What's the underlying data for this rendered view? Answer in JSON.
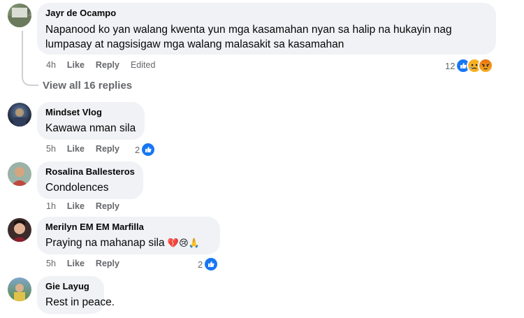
{
  "comments": [
    {
      "author": "Jayr de Ocampo",
      "lines": [
        "Napanood ko yan walang kwenta yun mga kasamahan nyan sa halip na hukayin nag",
        "lumpasay at nagsisigaw mga walang malasakit sa kasamahan"
      ],
      "time": "4h",
      "like": "Like",
      "reply": "Reply",
      "edited": "Edited",
      "reaction_count": "12",
      "reactions": [
        "like-icon",
        "sad-icon",
        "angry-icon"
      ]
    },
    {
      "author": "Mindset Vlog",
      "text": "Kawawa nman sila",
      "time": "5h",
      "like": "Like",
      "reply": "Reply",
      "reaction_count": "2"
    },
    {
      "author": "Rosalina Ballesteros",
      "text": "Condolences",
      "time": "1h",
      "like": "Like",
      "reply": "Reply"
    },
    {
      "author": "Merilyn EM EM Marfilla",
      "text": "Praying na mahanap sila",
      "emojis": "💔😢🙏",
      "time": "5h",
      "like": "Like",
      "reply": "Reply",
      "reaction_count": "2"
    },
    {
      "author": "Gie Layug",
      "text": "Rest in peace."
    }
  ],
  "view_all_replies": "View all 16 replies",
  "colors": {
    "like_blue": "#1877f2",
    "bubble": "#f0f2f5",
    "meta": "#65676b"
  }
}
